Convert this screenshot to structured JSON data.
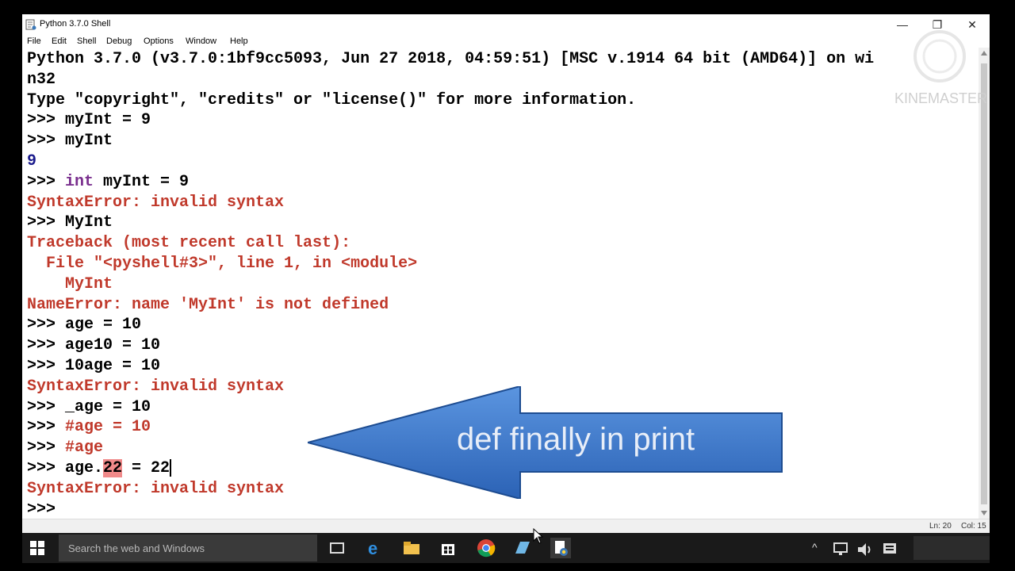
{
  "window": {
    "title": "Python 3.7.0 Shell",
    "controls": {
      "minimize": "—",
      "restore": "❐",
      "close": "✕"
    }
  },
  "menu": [
    "File",
    "Edit",
    "Shell",
    "Debug",
    "Options",
    "Window",
    "Help"
  ],
  "shell": {
    "lines": [
      {
        "t": "Python 3.7.0 (v3.7.0:1bf9cc5093, Jun 27 2018, 04:59:51) [MSC v.1914 64 bit (AMD64)] on wi"
      },
      {
        "t": "n32"
      },
      {
        "t": "Type \"copyright\", \"credits\" or \"license()\" for more information."
      },
      {
        "p": ">>> ",
        "t": "myInt = 9"
      },
      {
        "p": ">>> ",
        "t": "myInt"
      },
      {
        "t": "9",
        "c": "out"
      },
      {
        "p": ">>> ",
        "kw": "int",
        "t": " myInt = 9"
      },
      {
        "t": "SyntaxError: invalid syntax",
        "c": "err"
      },
      {
        "p": ">>> ",
        "t": "MyInt"
      },
      {
        "t": "Traceback (most recent call last):",
        "c": "err"
      },
      {
        "t": "  File \"<pyshell#3>\", line 1, in <module>",
        "c": "err"
      },
      {
        "t": "    MyInt",
        "c": "err"
      },
      {
        "t": "NameError: name 'MyInt' is not defined",
        "c": "err"
      },
      {
        "p": ">>> ",
        "t": "age = 10"
      },
      {
        "p": ">>> ",
        "t": "age10 = 10"
      },
      {
        "p": ">>> ",
        "t": "10age = 10"
      },
      {
        "t": "SyntaxError: invalid syntax",
        "c": "err"
      },
      {
        "p": ">>> ",
        "t": "_age = 10"
      },
      {
        "p": ">>> ",
        "t": "#age = 10",
        "tc": "err"
      },
      {
        "p": ">>> ",
        "t": "#age",
        "tc": "err"
      },
      {
        "p": ">>> ",
        "t": "age.",
        "hl": "22",
        "t2": " = 22",
        "caret": true
      },
      {
        "t": "SyntaxError: invalid syntax",
        "c": "err"
      },
      {
        "p": ">>> ",
        "t": ""
      }
    ]
  },
  "status": {
    "line": "Ln: 20",
    "col": "Col: 15"
  },
  "overlay": {
    "arrow_label": "def finally in print",
    "watermark": "KINEMASTER",
    "watermark_icon": "kinemaster-logo-icon"
  },
  "taskbar": {
    "search_placeholder": "Search the web and Windows",
    "icons": [
      "task-view-icon",
      "edge-icon",
      "file-explorer-icon",
      "store-icon",
      "chrome-icon",
      "app-icon",
      "python-idle-icon"
    ]
  },
  "colors": {
    "prompt": "#000000",
    "output": "#1a1a8c",
    "error": "#c0392b",
    "keyword": "#7a2f8e",
    "highlight": "#f08a8a",
    "arrow": "#3d7dd1"
  }
}
